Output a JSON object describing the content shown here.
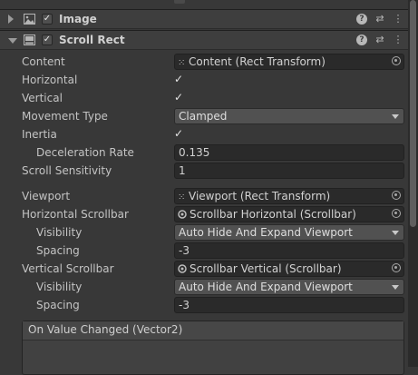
{
  "components": {
    "image": {
      "title": "Image",
      "enabled": true
    },
    "scroll_rect": {
      "title": "Scroll Rect",
      "enabled": true
    }
  },
  "icons": {
    "help": "help-icon",
    "presets": "presets-icon",
    "menu": "context-menu-icon",
    "object_picker": "object-picker-icon"
  },
  "fields": {
    "content": {
      "label": "Content",
      "value": "Content (Rect Transform)"
    },
    "horizontal": {
      "label": "Horizontal",
      "checked": true
    },
    "vertical": {
      "label": "Vertical",
      "checked": true
    },
    "movement_type": {
      "label": "Movement Type",
      "value": "Clamped"
    },
    "inertia": {
      "label": "Inertia",
      "checked": true
    },
    "deceleration_rate": {
      "label": "Deceleration Rate",
      "value": "0.135"
    },
    "scroll_sensitivity": {
      "label": "Scroll Sensitivity",
      "value": "1"
    },
    "viewport": {
      "label": "Viewport",
      "value": "Viewport (Rect Transform)"
    },
    "horizontal_scrollbar": {
      "label": "Horizontal Scrollbar",
      "value": "Scrollbar Horizontal (Scrollbar)"
    },
    "h_visibility": {
      "label": "Visibility",
      "value": "Auto Hide And Expand Viewport"
    },
    "h_spacing": {
      "label": "Spacing",
      "value": "-3"
    },
    "vertical_scrollbar": {
      "label": "Vertical Scrollbar",
      "value": "Scrollbar Vertical (Scrollbar)"
    },
    "v_visibility": {
      "label": "Visibility",
      "value": "Auto Hide And Expand Viewport"
    },
    "v_spacing": {
      "label": "Spacing",
      "value": "-3"
    }
  },
  "events": {
    "on_value_changed": "On Value Changed (Vector2)"
  },
  "glyphs": {
    "check": "✓",
    "help": "?",
    "presets": "⇄",
    "menu": "⋮",
    "object": "⁙"
  }
}
